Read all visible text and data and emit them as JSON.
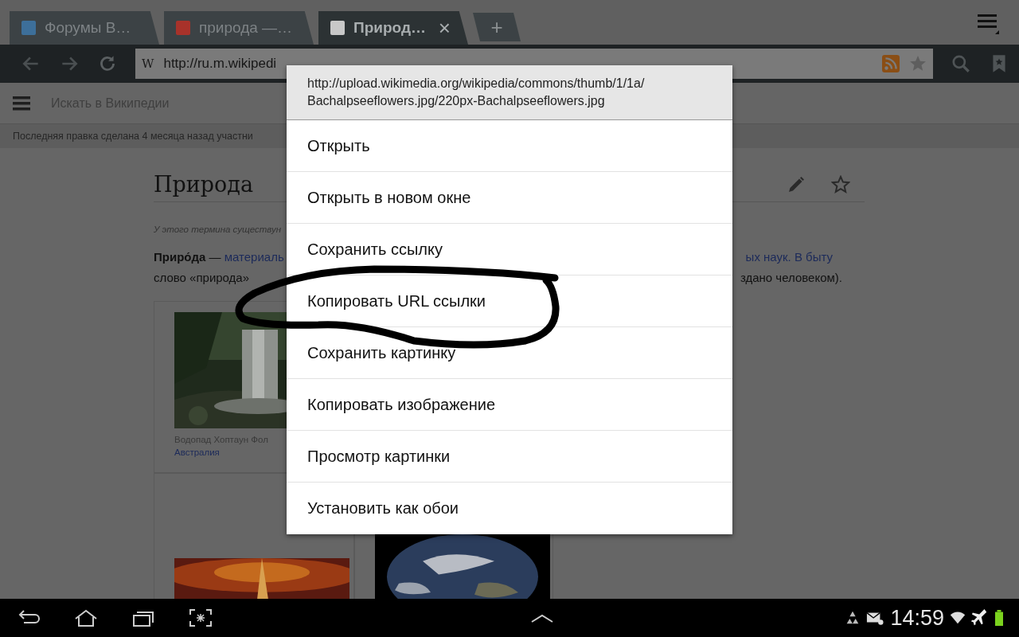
{
  "browser": {
    "tabs": [
      {
        "title": "Форумы В…",
        "color": "#3d6f9a",
        "selected": false
      },
      {
        "title": "природа —…",
        "color": "#a8322a",
        "selected": false
      },
      {
        "title": "Природ…",
        "color": "#c8c8c8",
        "selected": true,
        "close_label": "×"
      }
    ],
    "new_tab_label": "+",
    "address_bar": {
      "site_label": "W",
      "value": "http://ru.m.wikipedi"
    }
  },
  "wiki_header": {
    "search_placeholder": "Искать в Википедии"
  },
  "last_edit": "Последняя правка сделана 4 месяца назад участни",
  "article": {
    "title": "Природа",
    "hatnote": "У этого термина существун",
    "lines": [
      {
        "left": "**Приро́да** — ",
        "left_link": "материаль",
        "right": "ых наук. В быту",
        "right_link": true
      },
      {
        "left": "слово «природа»",
        "right": "здано человеком).",
        "right_link": false
      }
    ],
    "gallery": [
      {
        "kind": "waterfall",
        "caption": "Водопад Хоптаун Фол",
        "caption_link": "Австралия"
      },
      {
        "kind": "fire"
      },
      {
        "kind": "earth"
      }
    ]
  },
  "context_menu": {
    "url_lines": [
      "http://upload.wikimedia.org/wikipedia/commons/thumb/1/1a/",
      "Bachalpseeflowers.jpg/220px-Bachalpseeflowers.jpg"
    ],
    "items": [
      "Открыть",
      "Открыть в новом окне",
      "Сохранить ссылку",
      "Копировать URL ссылки",
      "Сохранить картинку",
      "Копировать изображение",
      "Просмотр картинки",
      "Установить как обои"
    ]
  },
  "status_bar": {
    "time": "14:59"
  }
}
